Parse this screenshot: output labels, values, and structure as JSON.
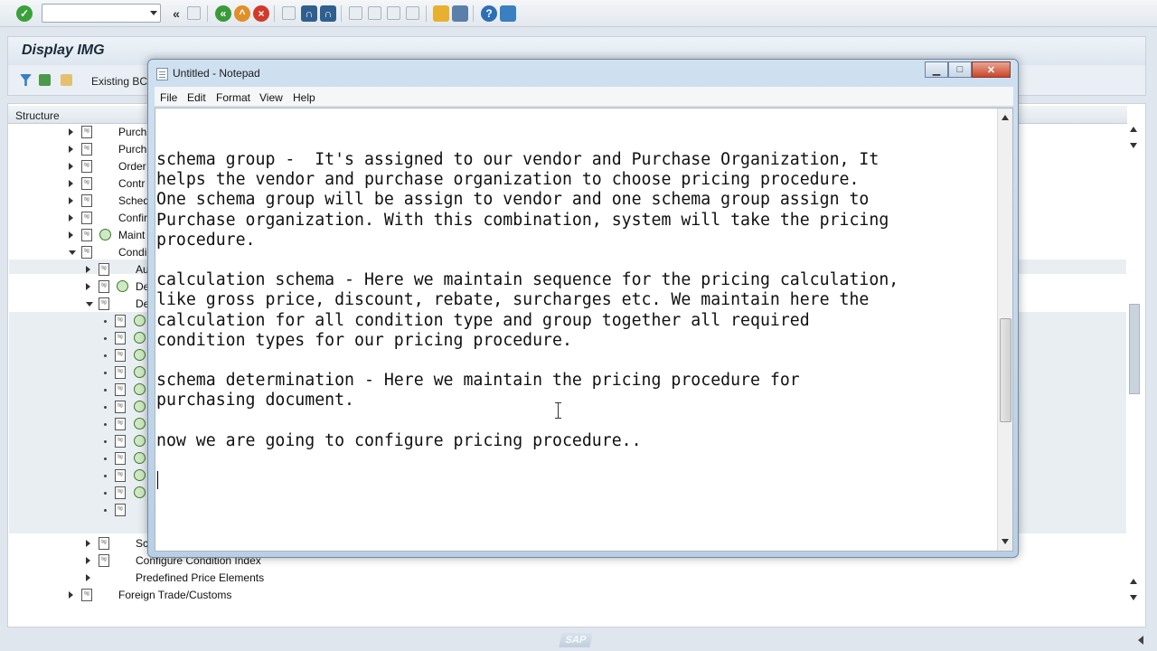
{
  "sap": {
    "screen_title": "Display IMG",
    "toolbar_button": "Existing BC",
    "structure_header": "Structure",
    "tree": [
      {
        "label": "Purch",
        "level": 1,
        "state": "collapsed",
        "icon": "doc"
      },
      {
        "label": "Purch",
        "level": 1,
        "state": "collapsed",
        "icon": "doc"
      },
      {
        "label": "Order",
        "level": 1,
        "state": "collapsed",
        "icon": "doc"
      },
      {
        "label": "Contr",
        "level": 1,
        "state": "collapsed",
        "icon": "doc"
      },
      {
        "label": "Sched",
        "level": 1,
        "state": "collapsed",
        "icon": "doc"
      },
      {
        "label": "Confir",
        "level": 1,
        "state": "collapsed",
        "icon": "doc"
      },
      {
        "label": "Maint",
        "level": 1,
        "state": "collapsed",
        "icon": "doc-exec"
      },
      {
        "label": "Condi",
        "level": 1,
        "state": "expanded",
        "icon": "doc"
      },
      {
        "label": "Au",
        "level": 2,
        "state": "collapsed",
        "icon": "doc"
      },
      {
        "label": "De",
        "level": 2,
        "state": "collapsed",
        "icon": "doc-exec"
      },
      {
        "label": "De",
        "level": 2,
        "state": "expanded",
        "icon": "doc"
      },
      {
        "label": "Sc",
        "level": 2,
        "state": "collapsed",
        "icon": "doc"
      },
      {
        "label": "Configure Condition Index",
        "level": 2,
        "state": "collapsed",
        "icon": "doc"
      },
      {
        "label": "Predefined Price Elements",
        "level": 2,
        "state": "collapsed",
        "icon": "none"
      },
      {
        "label": "Foreign Trade/Customs",
        "level": 1,
        "state": "collapsed",
        "icon": "doc"
      }
    ],
    "leaf_rows": 12
  },
  "notepad": {
    "title": "Untitled - Notepad",
    "menu": [
      "File",
      "Edit",
      "Format",
      "View",
      "Help"
    ],
    "window_buttons": {
      "minimize": "minimize-icon",
      "maximize": "maximize-icon",
      "close": "close-icon"
    },
    "lines": [
      "schema group -  It's assigned to our vendor and Purchase Organization, It",
      "helps the vendor and purchase organization to choose pricing procedure.",
      "One schema group will be assign to vendor and one schema group assign to",
      "Purchase organization. With this combination, system will take the pricing",
      "procedure.",
      "",
      "calculation schema - Here we maintain sequence for the pricing calculation,",
      "like gross price, discount, rebate, surcharges etc. We maintain here the",
      "calculation for all condition type and group together all required",
      "condition types for our pricing procedure.",
      "",
      "schema determination - Here we maintain the pricing procedure for",
      "purchasing document.",
      "",
      "now we are going to configure pricing procedure..",
      ""
    ]
  },
  "colors": {
    "notepad_frame": "#b9cfe4",
    "close_button": "#c9452a",
    "sap_background": "#dfe6ee",
    "execute_icon": "#3b7a2a"
  },
  "logo": "SAP"
}
